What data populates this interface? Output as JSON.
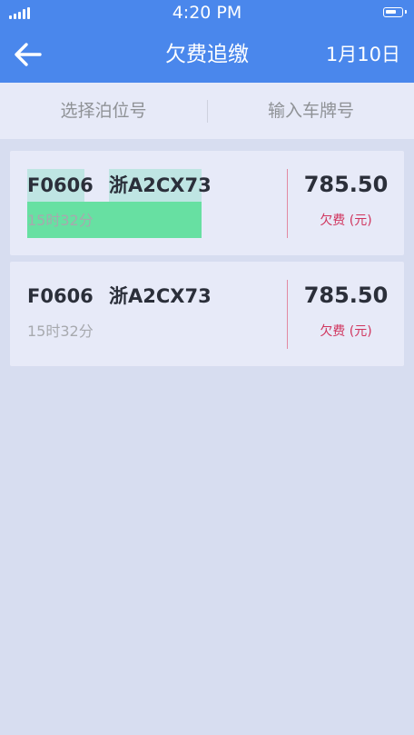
{
  "status_bar": {
    "time": "4:20 PM"
  },
  "nav": {
    "title": "欠费追缴",
    "date": "1月10日"
  },
  "search": {
    "berth_placeholder": "选择泊位号",
    "plate_placeholder": "输入车牌号"
  },
  "records": [
    {
      "space_no": "F0606",
      "plate": "浙A2CX73",
      "duration": "15时32分",
      "amount": "785.50",
      "amount_label": "欠费 (元)"
    },
    {
      "space_no": "F0606",
      "plate": "浙A2CX73",
      "duration": "15时32分",
      "amount": "785.50",
      "amount_label": "欠费 (元)"
    }
  ],
  "colors": {
    "primary": "#4a87ec",
    "background": "#d7ddf0",
    "card": "#e7eaf8",
    "debt_label": "#d0345d",
    "highlight_green": "#67e0a2",
    "highlight_teal": "#bfe5e3"
  },
  "icons": {
    "back": "arrow-left-icon",
    "signal": "signal-icon",
    "battery": "battery-icon"
  }
}
